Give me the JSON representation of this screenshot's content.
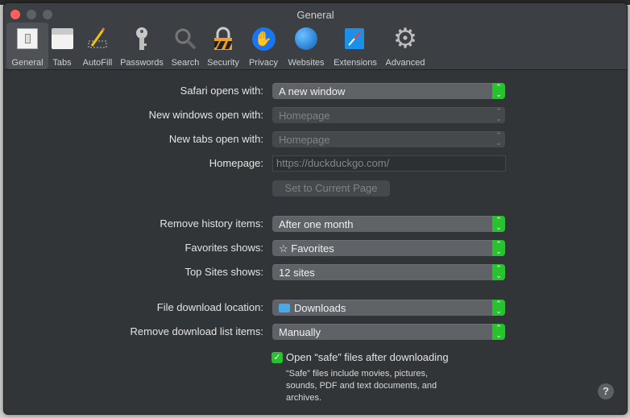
{
  "window": {
    "title": "General"
  },
  "toolbar": {
    "items": [
      {
        "label": "General",
        "icon": "general-icon"
      },
      {
        "label": "Tabs",
        "icon": "tabs-icon"
      },
      {
        "label": "AutoFill",
        "icon": "pencil-icon"
      },
      {
        "label": "Passwords",
        "icon": "key-icon"
      },
      {
        "label": "Search",
        "icon": "magnifier-icon"
      },
      {
        "label": "Security",
        "icon": "lock-icon"
      },
      {
        "label": "Privacy",
        "icon": "hand-icon"
      },
      {
        "label": "Websites",
        "icon": "globe-icon"
      },
      {
        "label": "Extensions",
        "icon": "compass-puzzle-icon"
      },
      {
        "label": "Advanced",
        "icon": "gear-icon"
      }
    ]
  },
  "form": {
    "safari_opens_label": "Safari opens with:",
    "safari_opens_value": "A new window",
    "new_windows_label": "New windows open with:",
    "new_windows_value": "Homepage",
    "new_tabs_label": "New tabs open with:",
    "new_tabs_value": "Homepage",
    "homepage_label": "Homepage:",
    "homepage_value": "https://duckduckgo.com/",
    "set_current_label": "Set to Current Page",
    "remove_history_label": "Remove history items:",
    "remove_history_value": "After one month",
    "favorites_label": "Favorites shows:",
    "favorites_value": "☆ Favorites",
    "top_sites_label": "Top Sites shows:",
    "top_sites_value": "12 sites",
    "download_location_label": "File download location:",
    "download_location_value": "Downloads",
    "remove_download_label": "Remove download list items:",
    "remove_download_value": "Manually",
    "open_safe_label": "Open “safe” files after downloading",
    "open_safe_checked": true,
    "open_safe_note": "“Safe” files include movies, pictures, sounds, PDF and text documents, and archives.",
    "help": "?"
  },
  "colors": {
    "accent": "#28c22f",
    "close": "#fe5f57"
  }
}
